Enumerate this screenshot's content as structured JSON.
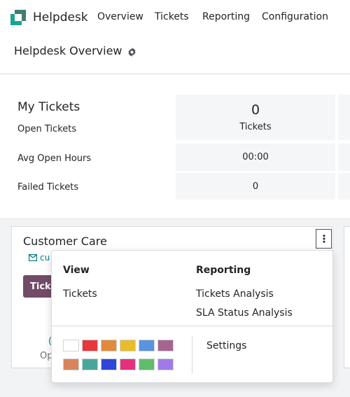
{
  "navbar": {
    "app_name": "Helpdesk",
    "menu": [
      "Overview",
      "Tickets",
      "Reporting",
      "Configuration"
    ]
  },
  "control_panel": {
    "title": "Helpdesk Overview",
    "settings_icon": "gear-icon"
  },
  "my_tickets": {
    "title": "My Tickets",
    "rows": [
      "Open Tickets",
      "Avg Open Hours",
      "Failed Tickets"
    ],
    "tickets_count": "0",
    "tickets_caption": "Tickets",
    "avg_open_hours": "00:00",
    "failed_tickets": "0"
  },
  "team_card": {
    "title": "Customer Care",
    "email_partial": "cu",
    "button_partial": "Tick",
    "teal_partial": "(",
    "stat_partial": "Op",
    "menu_icon": "kebab-vertical-icon"
  },
  "dropdown": {
    "view_header": "View",
    "view_items": [
      "Tickets"
    ],
    "reporting_header": "Reporting",
    "reporting_items": [
      "Tickets Analysis",
      "SLA Status Analysis"
    ],
    "settings_label": "Settings",
    "colors": [
      "#ffffff",
      "#e8363b",
      "#e08a3c",
      "#e9bb2d",
      "#5b93de",
      "#a5658e",
      "#d9845c",
      "#49a79a",
      "#2f46d8",
      "#e3317e",
      "#5fbd6b",
      "#a07be8"
    ]
  },
  "theme": {
    "brand_primary": "#714b67",
    "teal": "#017e84",
    "logo_teal": "#1ba491",
    "logo_dark": "#21655c"
  }
}
